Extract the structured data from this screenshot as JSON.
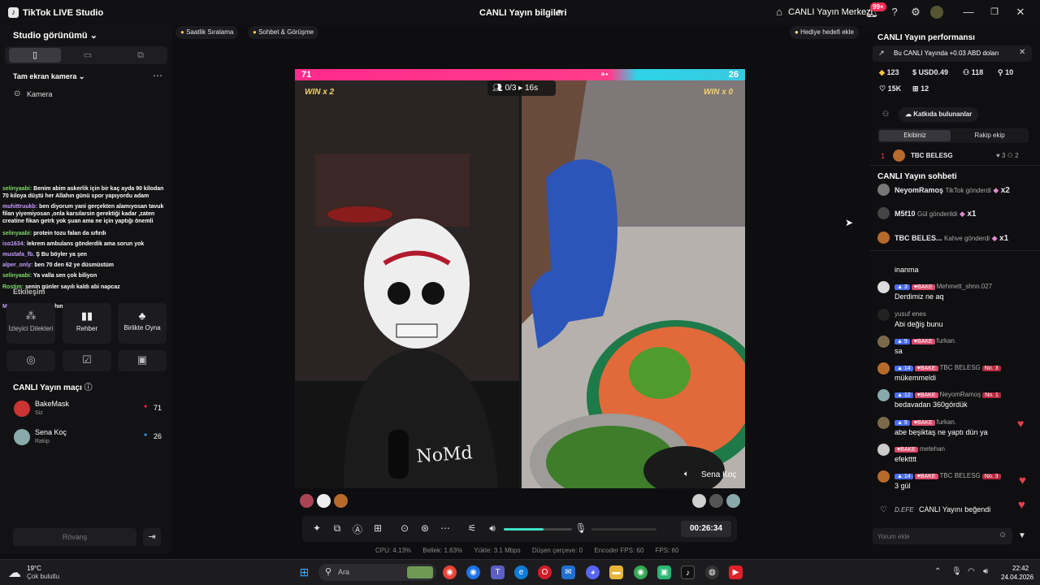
{
  "titlebar": {
    "app_name": "TikTok LIVE Studio",
    "live_info": "CANLI Yayın bilgileri",
    "live_center": "CANLI Yayın Merkezi",
    "notif_badge": "99+"
  },
  "top_chips": {
    "hourly_rank": "Saatlik Sıralama",
    "chat_meet": "Sohbet & Görüşme",
    "gift_goal": "Hediye hedefi ekle"
  },
  "left": {
    "studio_view": "Studio görünümü",
    "source_title": "Tam ekran kamera",
    "camera_label": "Kamera",
    "chat": [
      {
        "user": "selinyaabi:",
        "text": "Benim abim askerlik için bir kaç ayda 90 kilodan 70 kiloya düştü her Allahın günü spor yapıyordu adam",
        "cls": "n"
      },
      {
        "user": "muhittruukb:",
        "text": "ben diyorum yani gerçekten alamıyosan tavuk filan yiyemiyosan ,onla karsılarsin gerektiği kadar ,zaten creatine fikan getrk yok şuan ama ne için yaptığı önemli",
        "cls": "p"
      },
      {
        "user": "selinyaabi:",
        "text": "protein tozu falan da sıfırdı",
        "cls": "n"
      },
      {
        "user": "iso1634:",
        "text": "lekrem ambulans gönderdik ama sorun yok",
        "cls": "p"
      },
      {
        "user": "mustafa_fb.",
        "text": "Ş Bu böyler ya şen",
        "cls": "p"
      },
      {
        "user": "alper_only:",
        "text": "ben 70 den 62 ye düsmüstüm",
        "cls": "p"
      },
      {
        "user": "selinyaabi:",
        "text": "Ya valla sen çok biliyon",
        "cls": "n"
      },
      {
        "user": "Rostim:",
        "text": "senin günler sayılı kaldı abi napcaz",
        "cls": "n"
      },
      {
        "user": "MehmeTalhaa:",
        "text": "nikahınamı alacan senaa",
        "cls": "p"
      }
    ],
    "interaction_title": "Etkileşim",
    "tiles": [
      "İzleyici Dilekleri",
      "Rehber",
      "Birlikte Oyna"
    ],
    "match_title": "CANLI Yayın maçı",
    "players": [
      {
        "name": "BakeMask",
        "sub": "Siz",
        "score": "71"
      },
      {
        "name": "Sena Koç",
        "sub": "Rakip",
        "score": "26"
      }
    ],
    "rematch": "Rövanş"
  },
  "stage": {
    "score_left": "71",
    "score_right": "26",
    "win_left": "WIN x 2",
    "win_right": "WIN x 0",
    "round": "0/3",
    "timer": "16s",
    "right_name": "Sena Koç",
    "duration": "00:26:34",
    "volume_level": 0.58
  },
  "stats": {
    "cpu": "CPU: 4.13%",
    "mem": "Bellek: 1.63%",
    "upload": "Yükle: 3.1 Mbps",
    "dropped": "Düşen çerçeve: 0",
    "encoder": "Encoder FPS: 60",
    "fps": "FPS: 60"
  },
  "right": {
    "perf_title": "CANLI Yayın performansı",
    "earn_banner": "Bu CANLI Yayında +0.03 ABD doları",
    "m1": "123",
    "m2": "USD0.49",
    "m3": "118",
    "m4": "10",
    "m5": "15K",
    "m6": "12",
    "contrib": "Katkıda bulunanlar",
    "tab_us": "Ekibiniz",
    "tab_them": "Rakip ekip",
    "top_rank": "1",
    "top_name": "TBC BELESG",
    "top_a": "3",
    "top_b": "2",
    "chat_title": "CANLI Yayın sohbeti",
    "gifts": [
      {
        "user": "NeyomRamoş",
        "text": "TikTok gönderdi",
        "count": "x2"
      },
      {
        "user": "M5f10",
        "text": "Gül gönderildi",
        "count": "x1"
      },
      {
        "user": "TBC BELES...",
        "text": "Kahve gönderdi",
        "count": "x1"
      }
    ],
    "messages": [
      {
        "user": "",
        "text": "inanma"
      },
      {
        "lv": "3",
        "fan": "BAKE",
        "user": "Mehmett_shnn.027",
        "text": "Derdimiz ne aq"
      },
      {
        "user": "yusuf enes",
        "text": "Abi değiş bunu"
      },
      {
        "lv": "9",
        "fan": "BAKE",
        "user": "furkan.",
        "text": "sa"
      },
      {
        "lv": "14",
        "fan": "BAKE",
        "user": "TBC BELESG",
        "no": "No. 3",
        "text": "mükemmeldi"
      },
      {
        "lv": "12",
        "fan": "BAKE",
        "user": "NeyomRamoş",
        "no": "No. 1",
        "text": "bedavadan 360gördük"
      },
      {
        "lv": "9",
        "fan": "BAKE",
        "user": "furkan.",
        "text": "abe beşiktaş ne yaptı dün ya"
      },
      {
        "fan": "BAKE",
        "user": "metehan",
        "text": "efektttt"
      },
      {
        "lv": "14",
        "fan": "BAKE",
        "user": "TBC BELESG",
        "no": "No. 3",
        "text": "3 gül"
      }
    ],
    "liked_user": "D.EFE",
    "liked_text": "CANLI Yayını beğendi",
    "comment_placeholder": "Yorum ekle"
  },
  "taskbar": {
    "temp": "19°C",
    "weather": "Çok bulutlu",
    "search": "Ara",
    "time": "22:42",
    "date": "24.04.2026"
  }
}
